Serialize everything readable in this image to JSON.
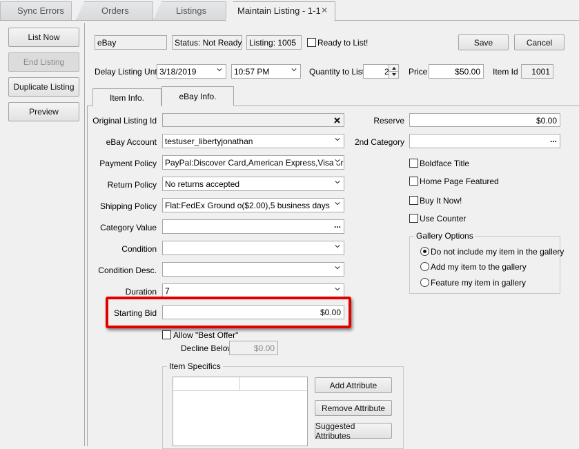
{
  "tabs": [
    {
      "label": "Sync Errors"
    },
    {
      "label": "Orders"
    },
    {
      "label": "Listings"
    },
    {
      "label": "Maintain Listing - 1-1"
    }
  ],
  "sidebar": {
    "list_now": "List Now",
    "end_listing": "End Listing",
    "duplicate_listing": "Duplicate Listing",
    "preview": "Preview"
  },
  "header": {
    "channel": "eBay",
    "status": "Status: Not Ready",
    "listing": "Listing: 1005",
    "ready_to_list": "Ready to List!",
    "save": "Save",
    "cancel": "Cancel",
    "delay_label": "Delay Listing Until",
    "delay_date": "3/18/2019",
    "delay_time": "10:57 PM",
    "qty_label": "Quantity to List",
    "qty_value": "2",
    "price_label": "Price",
    "price_value": "$50.00",
    "item_id_label": "Item Id",
    "item_id_value": "1001"
  },
  "subtabs": {
    "item_info": "Item Info.",
    "ebay_info": "eBay Info."
  },
  "form": {
    "original_listing_id": {
      "label": "Original Listing Id",
      "value": ""
    },
    "ebay_account": {
      "label": "eBay Account",
      "value": "testuser_libertyjonathan"
    },
    "payment_policy": {
      "label": "Payment Policy",
      "value": "PayPal:Discover Card,American Express,Visa or"
    },
    "return_policy": {
      "label": "Return Policy",
      "value": "No returns accepted"
    },
    "shipping_policy": {
      "label": "Shipping Policy",
      "value": "Flat:FedEx Ground o($2.00),5 business days"
    },
    "category_value": {
      "label": "Category Value",
      "value": ""
    },
    "condition": {
      "label": "Condition",
      "value": ""
    },
    "condition_desc": {
      "label": "Condition Desc.",
      "value": ""
    },
    "duration": {
      "label": "Duration",
      "value": "7"
    },
    "starting_bid": {
      "label": "Starting Bid",
      "value": "$0.00"
    },
    "allow_best_offer": "Allow \"Best Offer\"",
    "decline_below": {
      "label": "Decline Below",
      "value": "$0.00"
    },
    "ellipsis": "..."
  },
  "right": {
    "reserve": {
      "label": "Reserve",
      "value": "$0.00"
    },
    "second_category": {
      "label": "2nd Category",
      "value": ""
    },
    "boldface_title": "Boldface Title",
    "home_page_featured": "Home Page Featured",
    "buy_it_now": "Buy It Now!",
    "use_counter": "Use Counter",
    "gallery_options": {
      "title": "Gallery Options",
      "options": [
        "Do not include my item in the gallery",
        "Add my item to the gallery",
        "Feature my item in gallery"
      ],
      "selected": "Do not include my item in the gallery"
    }
  },
  "specifics": {
    "title": "Item Specifics",
    "add": "Add Attribute",
    "remove": "Remove Attribute",
    "suggested": "Suggested Attributes"
  },
  "colors": {
    "highlight": "#e00000"
  }
}
